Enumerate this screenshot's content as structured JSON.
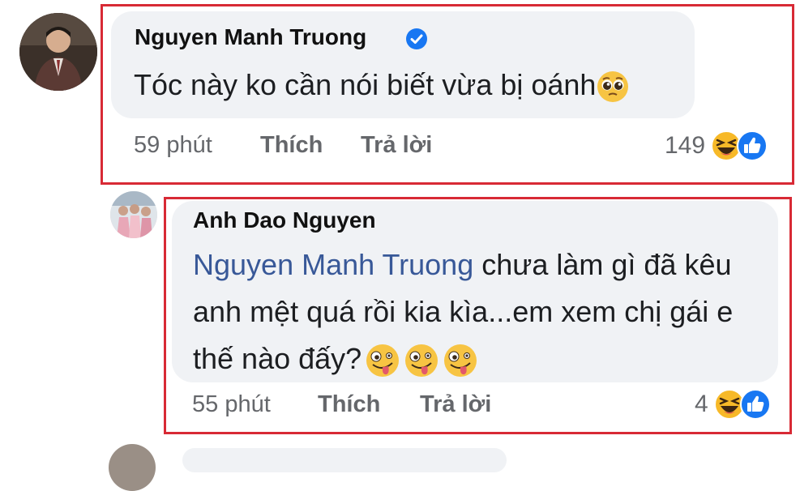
{
  "comments": [
    {
      "author": "Nguyen Manh Truong",
      "verified": true,
      "text": "Tóc này ko cần nói biết vừa bị oánh",
      "text_emoji": "pleading-face",
      "time": "59 phút",
      "like_label": "Thích",
      "reply_label": "Trả lời",
      "reaction_count": "149",
      "reactions": [
        "haha",
        "like"
      ]
    },
    {
      "author": "Anh Dao Nguyen",
      "verified": false,
      "mention": "Nguyen Manh Truong",
      "text": " chưa làm gì đã kêu anh mệt quá rồi kia kìa...em xem chị gái e thế nào đấy?",
      "text_emoji": [
        "zany-face",
        "zany-face",
        "zany-face"
      ],
      "time": "55 phút",
      "like_label": "Thích",
      "reply_label": "Trả lời",
      "reaction_count": "4",
      "reactions": [
        "haha",
        "like"
      ]
    }
  ],
  "colors": {
    "highlight_frame": "#d82a35",
    "bubble": "#f0f2f5",
    "mention": "#385898",
    "meta": "#65676b",
    "verified": "#1877f2",
    "like": "#1877f2",
    "haha": "#f7b928"
  }
}
